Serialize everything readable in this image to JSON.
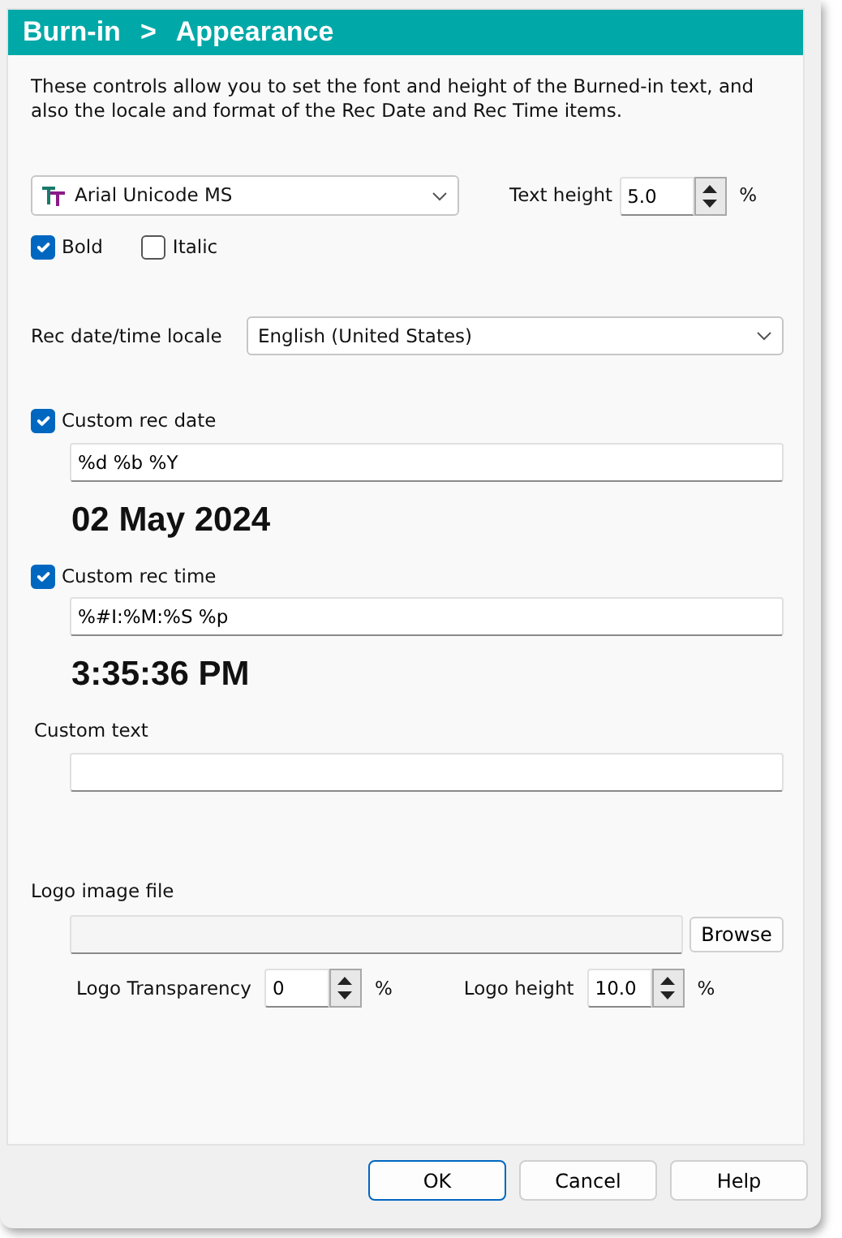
{
  "header": {
    "section": "Burn-in",
    "separator": ">",
    "page": "Appearance"
  },
  "description": "These controls allow you to set the font and height of the Burned-in text, and also the locale and format of the Rec Date and Rec Time items.",
  "font": {
    "value": "Arial Unicode MS"
  },
  "text_height": {
    "label": "Text height",
    "value": "5.0",
    "unit": "%"
  },
  "style_options": [
    {
      "label": "Bold",
      "checked": true
    },
    {
      "label": "Italic",
      "checked": false
    }
  ],
  "locale": {
    "label": "Rec date/time locale",
    "value": "English (United States)"
  },
  "custom_formats": [
    {
      "label": "Custom rec date",
      "checked": true,
      "format": "%d %b %Y",
      "preview": "02 May 2024"
    },
    {
      "label": "Custom rec time",
      "checked": true,
      "format": "%#I:%M:%S %p",
      "preview": "3:35:36 PM"
    }
  ],
  "custom_text": {
    "label": "Custom text"
  },
  "logo": {
    "label": "Logo image file",
    "browse": "Browse",
    "spins": [
      {
        "label": "Logo Transparency",
        "value": "0",
        "unit": "%"
      },
      {
        "label": "Logo height",
        "value": "10.0",
        "unit": "%"
      }
    ]
  },
  "buttons": [
    {
      "label": "OK",
      "default": true
    },
    {
      "label": "Cancel",
      "default": false
    },
    {
      "label": "Help",
      "default": false
    }
  ]
}
